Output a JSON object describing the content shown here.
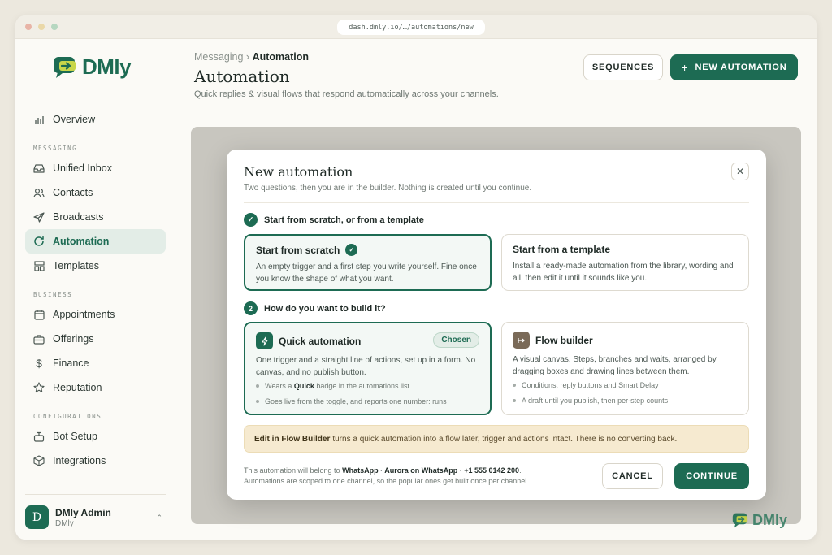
{
  "browser": {
    "url": "dash.dmly.io/…/automations/new"
  },
  "brand": {
    "name": "DMly",
    "accent": "#1d6b53"
  },
  "sidebar": {
    "overview": "Overview",
    "messaging_label": "MESSAGING",
    "messaging": [
      "Unified Inbox",
      "Contacts",
      "Broadcasts",
      "Automation",
      "Templates"
    ],
    "business_label": "BUSINESS",
    "business": [
      "Appointments",
      "Offerings",
      "Finance",
      "Reputation"
    ],
    "config_label": "CONFIGURATIONS",
    "config": [
      "Bot Setup",
      "Integrations"
    ],
    "active": "Automation",
    "profile": {
      "initial": "D",
      "name": "DMly Admin",
      "sub": "DMly"
    }
  },
  "header": {
    "crumb_parent": "Messaging ›",
    "crumb_current": "Automation",
    "title": "Automation",
    "subtitle": "Quick replies & visual flows that respond automatically across your channels.",
    "sequences_label": "SEQUENCES",
    "new_label": "NEW AUTOMATION"
  },
  "modal": {
    "title": "New automation",
    "subtitle": "Two questions, then you are in the builder. Nothing is created until you continue.",
    "step1": {
      "badge": "✓",
      "label": "Start from scratch, or from a template"
    },
    "scratch": {
      "title": "Start from scratch",
      "desc": "An empty trigger and a first step you write yourself. Fine once you know the shape of what you want."
    },
    "template": {
      "title": "Start from a template",
      "desc": "Install a ready-made automation from the library, wording and all, then edit it until it sounds like you."
    },
    "step2": {
      "badge": "2",
      "label": "How do you want to build it?"
    },
    "quick": {
      "title": "Quick automation",
      "chosen": "Chosen",
      "desc": "One trigger and a straight line of actions, set up in a form. No canvas, and no publish button.",
      "bullet1_pre": "Wears a",
      "bullet1_bold": "Quick",
      "bullet1_post": "badge in the automations list",
      "bullet2": "Goes live from the toggle, and reports one number: runs"
    },
    "flow": {
      "title": "Flow builder",
      "desc": "A visual canvas. Steps, branches and waits, arranged by dragging boxes and drawing lines between them.",
      "bullet1": "Conditions, reply buttons and Smart Delay",
      "bullet2": "A draft until you publish, then per-step counts"
    },
    "note_bold": "Edit in Flow Builder",
    "note_text": "turns a quick automation into a flow later, trigger and actions intact. There is no converting back.",
    "footer_pre": "This automation will belong to",
    "footer_channel": "WhatsApp · Aurora on WhatsApp · +1 555 0142 200",
    "footer_line2": "Automations are scoped to one channel, so the popular ones get built once per channel.",
    "cancel_label": "CANCEL",
    "continue_label": "CONTINUE"
  }
}
